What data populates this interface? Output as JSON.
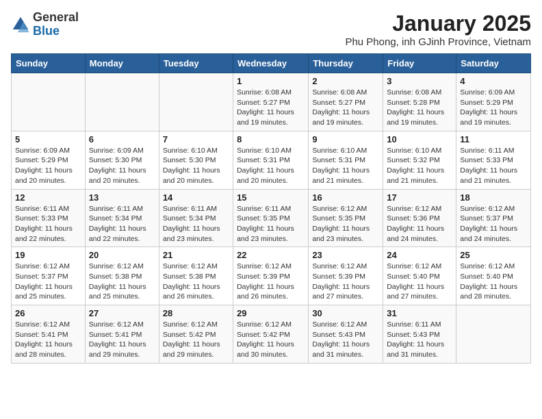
{
  "logo": {
    "general": "General",
    "blue": "Blue"
  },
  "title": "January 2025",
  "location": "Phu Phong, inh GJinh Province, Vietnam",
  "days_of_week": [
    "Sunday",
    "Monday",
    "Tuesday",
    "Wednesday",
    "Thursday",
    "Friday",
    "Saturday"
  ],
  "weeks": [
    [
      {
        "num": "",
        "info": ""
      },
      {
        "num": "",
        "info": ""
      },
      {
        "num": "",
        "info": ""
      },
      {
        "num": "1",
        "info": "Sunrise: 6:08 AM\nSunset: 5:27 PM\nDaylight: 11 hours\nand 19 minutes."
      },
      {
        "num": "2",
        "info": "Sunrise: 6:08 AM\nSunset: 5:27 PM\nDaylight: 11 hours\nand 19 minutes."
      },
      {
        "num": "3",
        "info": "Sunrise: 6:08 AM\nSunset: 5:28 PM\nDaylight: 11 hours\nand 19 minutes."
      },
      {
        "num": "4",
        "info": "Sunrise: 6:09 AM\nSunset: 5:29 PM\nDaylight: 11 hours\nand 19 minutes."
      }
    ],
    [
      {
        "num": "5",
        "info": "Sunrise: 6:09 AM\nSunset: 5:29 PM\nDaylight: 11 hours\nand 20 minutes."
      },
      {
        "num": "6",
        "info": "Sunrise: 6:09 AM\nSunset: 5:30 PM\nDaylight: 11 hours\nand 20 minutes."
      },
      {
        "num": "7",
        "info": "Sunrise: 6:10 AM\nSunset: 5:30 PM\nDaylight: 11 hours\nand 20 minutes."
      },
      {
        "num": "8",
        "info": "Sunrise: 6:10 AM\nSunset: 5:31 PM\nDaylight: 11 hours\nand 20 minutes."
      },
      {
        "num": "9",
        "info": "Sunrise: 6:10 AM\nSunset: 5:31 PM\nDaylight: 11 hours\nand 21 minutes."
      },
      {
        "num": "10",
        "info": "Sunrise: 6:10 AM\nSunset: 5:32 PM\nDaylight: 11 hours\nand 21 minutes."
      },
      {
        "num": "11",
        "info": "Sunrise: 6:11 AM\nSunset: 5:33 PM\nDaylight: 11 hours\nand 21 minutes."
      }
    ],
    [
      {
        "num": "12",
        "info": "Sunrise: 6:11 AM\nSunset: 5:33 PM\nDaylight: 11 hours\nand 22 minutes."
      },
      {
        "num": "13",
        "info": "Sunrise: 6:11 AM\nSunset: 5:34 PM\nDaylight: 11 hours\nand 22 minutes."
      },
      {
        "num": "14",
        "info": "Sunrise: 6:11 AM\nSunset: 5:34 PM\nDaylight: 11 hours\nand 23 minutes."
      },
      {
        "num": "15",
        "info": "Sunrise: 6:11 AM\nSunset: 5:35 PM\nDaylight: 11 hours\nand 23 minutes."
      },
      {
        "num": "16",
        "info": "Sunrise: 6:12 AM\nSunset: 5:35 PM\nDaylight: 11 hours\nand 23 minutes."
      },
      {
        "num": "17",
        "info": "Sunrise: 6:12 AM\nSunset: 5:36 PM\nDaylight: 11 hours\nand 24 minutes."
      },
      {
        "num": "18",
        "info": "Sunrise: 6:12 AM\nSunset: 5:37 PM\nDaylight: 11 hours\nand 24 minutes."
      }
    ],
    [
      {
        "num": "19",
        "info": "Sunrise: 6:12 AM\nSunset: 5:37 PM\nDaylight: 11 hours\nand 25 minutes."
      },
      {
        "num": "20",
        "info": "Sunrise: 6:12 AM\nSunset: 5:38 PM\nDaylight: 11 hours\nand 25 minutes."
      },
      {
        "num": "21",
        "info": "Sunrise: 6:12 AM\nSunset: 5:38 PM\nDaylight: 11 hours\nand 26 minutes."
      },
      {
        "num": "22",
        "info": "Sunrise: 6:12 AM\nSunset: 5:39 PM\nDaylight: 11 hours\nand 26 minutes."
      },
      {
        "num": "23",
        "info": "Sunrise: 6:12 AM\nSunset: 5:39 PM\nDaylight: 11 hours\nand 27 minutes."
      },
      {
        "num": "24",
        "info": "Sunrise: 6:12 AM\nSunset: 5:40 PM\nDaylight: 11 hours\nand 27 minutes."
      },
      {
        "num": "25",
        "info": "Sunrise: 6:12 AM\nSunset: 5:40 PM\nDaylight: 11 hours\nand 28 minutes."
      }
    ],
    [
      {
        "num": "26",
        "info": "Sunrise: 6:12 AM\nSunset: 5:41 PM\nDaylight: 11 hours\nand 28 minutes."
      },
      {
        "num": "27",
        "info": "Sunrise: 6:12 AM\nSunset: 5:41 PM\nDaylight: 11 hours\nand 29 minutes."
      },
      {
        "num": "28",
        "info": "Sunrise: 6:12 AM\nSunset: 5:42 PM\nDaylight: 11 hours\nand 29 minutes."
      },
      {
        "num": "29",
        "info": "Sunrise: 6:12 AM\nSunset: 5:42 PM\nDaylight: 11 hours\nand 30 minutes."
      },
      {
        "num": "30",
        "info": "Sunrise: 6:12 AM\nSunset: 5:43 PM\nDaylight: 11 hours\nand 31 minutes."
      },
      {
        "num": "31",
        "info": "Sunrise: 6:11 AM\nSunset: 5:43 PM\nDaylight: 11 hours\nand 31 minutes."
      },
      {
        "num": "",
        "info": ""
      }
    ]
  ]
}
